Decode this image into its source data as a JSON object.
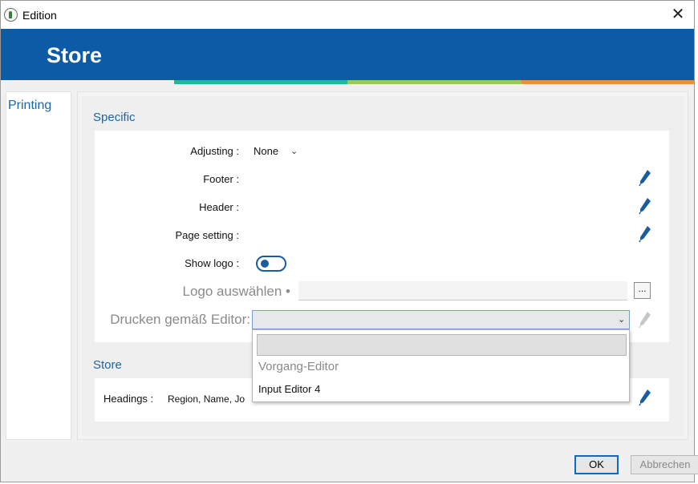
{
  "window": {
    "title": "Edition"
  },
  "banner": {
    "title": "Store"
  },
  "colors": {
    "accent": "#0b5ba7",
    "stripe": [
      "#1fb89f",
      "#9ac95a",
      "#e8913a"
    ]
  },
  "nav": {
    "items": [
      {
        "label": "Printing"
      }
    ]
  },
  "specific": {
    "title": "Specific",
    "adjusting": {
      "label": "Adjusting :",
      "value": "None"
    },
    "footer": {
      "label": "Footer :"
    },
    "header": {
      "label": "Header :"
    },
    "page_setting": {
      "label": "Page setting :"
    },
    "show_logo": {
      "label": "Show logo :",
      "on": true
    },
    "logo": {
      "label": "Logo auswählen •",
      "button": "..."
    },
    "print_editor": {
      "label": "Drucken gemäß Editor:",
      "value": "",
      "options": [
        "Vorgang-Editor",
        "Input Editor 4"
      ]
    }
  },
  "store": {
    "title": "Store",
    "headings": {
      "label": "Headings :",
      "value": "Region, Name, Jo"
    }
  },
  "footer_buttons": {
    "ok": "OK",
    "cancel": "Abbrechen"
  }
}
